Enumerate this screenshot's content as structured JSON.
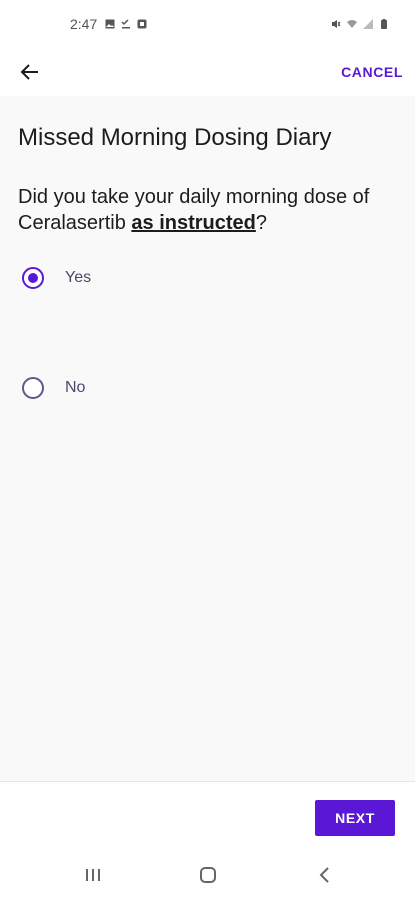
{
  "status_bar": {
    "time": "2:47",
    "left_icons": [
      "gallery-icon",
      "check-icon",
      "square-icon"
    ],
    "right_icons": [
      "mute-icon",
      "wifi-icon",
      "signal-icon",
      "battery-icon"
    ]
  },
  "app_bar": {
    "back_icon": "arrow-left-icon",
    "cancel_label": "CANCEL"
  },
  "page": {
    "title": "Missed Morning Dosing Diary",
    "question_prefix": "Did you take your daily morning dose of Ceralasertib ",
    "question_emphasis": "as instructed",
    "question_suffix": "?"
  },
  "options": [
    {
      "label": "Yes",
      "selected": true
    },
    {
      "label": "No",
      "selected": false
    }
  ],
  "footer": {
    "next_label": "NEXT"
  },
  "nav_bar": {
    "icons": [
      "recents-icon",
      "home-icon",
      "back-icon"
    ]
  },
  "colors": {
    "accent": "#5a18d6",
    "content_bg": "#f9f9f9"
  }
}
